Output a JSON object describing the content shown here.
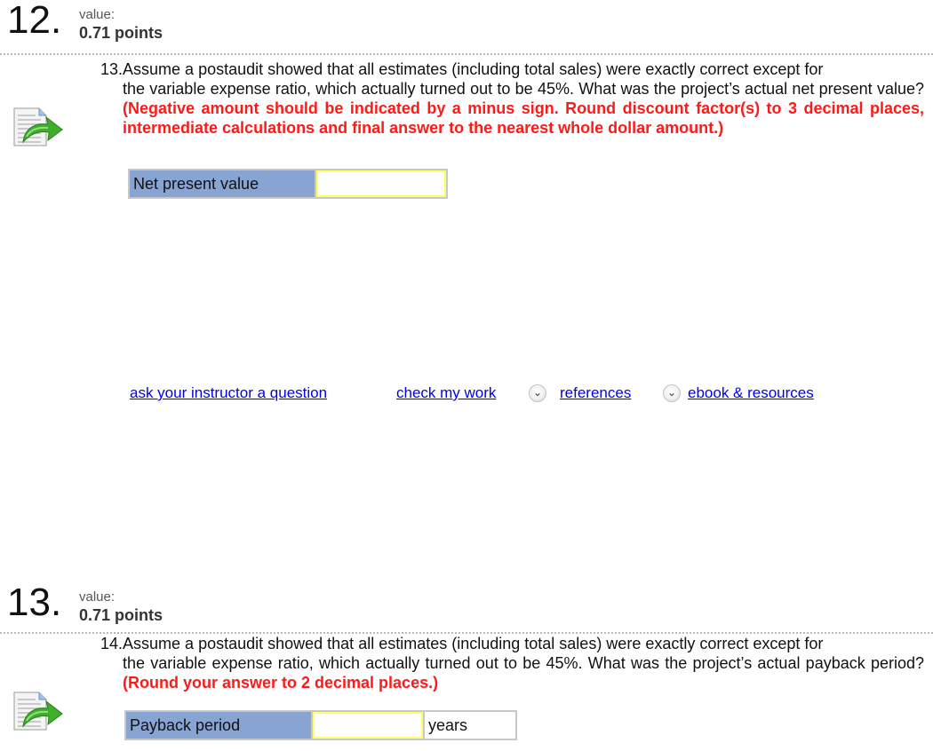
{
  "questions": [
    {
      "number": "12.",
      "value_label": "value:",
      "points": "0.71 points",
      "icon": "document-return-arrow-icon",
      "prompt_prefix": "13.",
      "prompt_first_line": "Assume a postaudit showed that all estimates (including total sales) were exactly correct except for",
      "prompt_rest": "the variable expense ratio, which actually turned out to be 45%. What was the project’s actual net present value?",
      "instructions": "(Negative amount should be indicated by a minus sign. Round discount factor(s) to 3 decimal places, intermediate calculations and final answer to the nearest whole dollar amount.)",
      "answer": {
        "label": "Net present value",
        "value": "",
        "placeholder": "",
        "unit": ""
      }
    },
    {
      "number": "13.",
      "value_label": "value:",
      "points": "0.71 points",
      "icon": "document-return-arrow-icon",
      "prompt_prefix": "14.",
      "prompt_first_line": "Assume a postaudit showed that all estimates (including total sales) were exactly correct except for",
      "prompt_rest": "the variable expense ratio, which actually turned out to be 45%. What was the project’s actual payback period?",
      "instructions": "(Round your answer to 2 decimal places.)",
      "answer": {
        "label": "Payback period",
        "value": "",
        "placeholder": "",
        "unit": "years"
      }
    }
  ],
  "links": {
    "ask_instructor": "ask your instructor a question",
    "check_work": "check my work",
    "references": "references",
    "ebook": "ebook & resources",
    "expand_icon": "double-chevron-down-icon"
  },
  "colors": {
    "instruction_red": "#ff1a1a",
    "label_blue": "#87a4d3",
    "input_border_yellow": "#ffff66",
    "link_blue": "#0000ee"
  }
}
